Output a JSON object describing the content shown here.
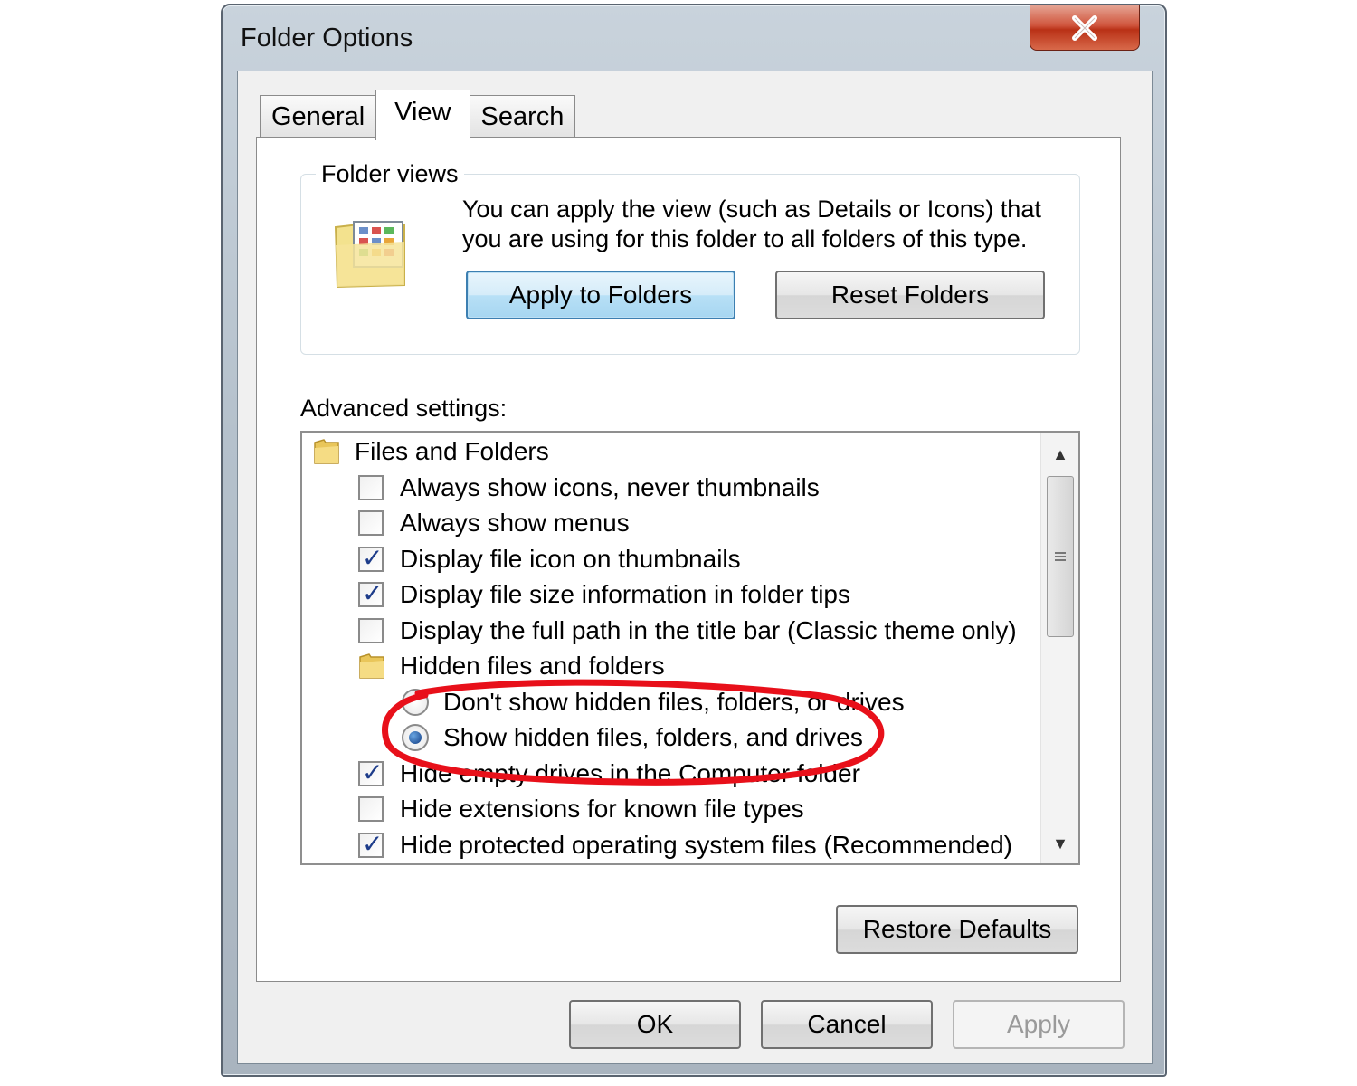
{
  "window": {
    "title": "Folder Options",
    "close_label": "✕"
  },
  "tabs": [
    {
      "label": "General",
      "active": false
    },
    {
      "label": "View",
      "active": true
    },
    {
      "label": "Search",
      "active": false
    }
  ],
  "folder_views": {
    "legend": "Folder views",
    "description": "You can apply the view (such as Details or Icons) that you are using for this folder to all folders of this type.",
    "apply_button": "Apply to Folders",
    "reset_button": "Reset Folders"
  },
  "advanced": {
    "label": "Advanced settings:",
    "items": [
      {
        "type": "folder",
        "label": "Files and Folders"
      },
      {
        "type": "checkbox",
        "label": "Always show icons, never thumbnails",
        "checked": false
      },
      {
        "type": "checkbox",
        "label": "Always show menus",
        "checked": false
      },
      {
        "type": "checkbox",
        "label": "Display file icon on thumbnails",
        "checked": true
      },
      {
        "type": "checkbox",
        "label": "Display file size information in folder tips",
        "checked": true
      },
      {
        "type": "checkbox",
        "label": "Display the full path in the title bar (Classic theme only)",
        "checked": false
      },
      {
        "type": "folder",
        "label": "Hidden files and folders"
      },
      {
        "type": "radio",
        "label": "Don't show hidden files, folders, or drives",
        "selected": false
      },
      {
        "type": "radio",
        "label": "Show hidden files, folders, and drives",
        "selected": true
      },
      {
        "type": "checkbox",
        "label": "Hide empty drives in the Computer folder",
        "checked": true
      },
      {
        "type": "checkbox",
        "label": "Hide extensions for known file types",
        "checked": false
      },
      {
        "type": "checkbox",
        "label": "Hide protected operating system files (Recommended)",
        "checked": true
      }
    ]
  },
  "restore_defaults_button": "Restore Defaults",
  "footer": {
    "ok": "OK",
    "cancel": "Cancel",
    "apply": "Apply"
  },
  "colors": {
    "annotation": "#e8101a",
    "focus_blue": "#3c7fb1"
  }
}
